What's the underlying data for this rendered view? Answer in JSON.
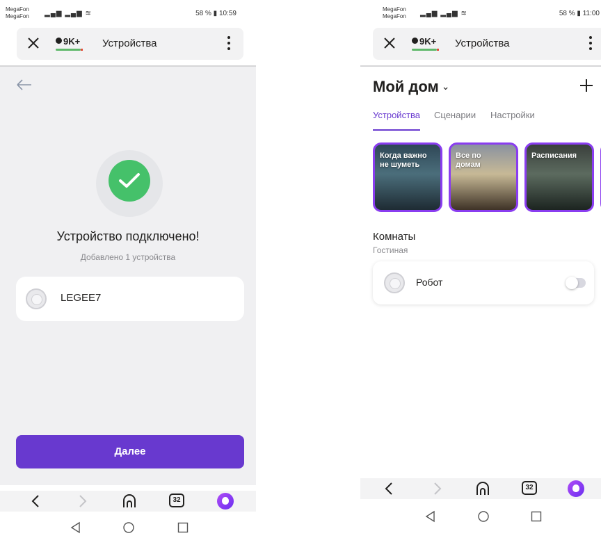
{
  "left_screen": {
    "status_bar": {
      "carrier_1": "MegaFon",
      "carrier_2": "MegaFon",
      "right_icons": "58 %",
      "time": "10:59"
    },
    "browser_bar": {
      "badge": "9K+",
      "title": "Устройства"
    },
    "success": {
      "title": "Устройство подключено!",
      "subtitle": "Добавлено 1 устройства"
    },
    "device": {
      "name": "LEGEE7"
    },
    "next_button": "Далее",
    "browser_nav": {
      "tabs_count": "32"
    }
  },
  "right_screen": {
    "status_bar": {
      "carrier_1": "MegaFon",
      "carrier_2": "MegaFon",
      "right_icons": "58 %",
      "time": "11:00"
    },
    "browser_bar": {
      "badge": "9K+",
      "title": "Устройства"
    },
    "home": {
      "title": "Мой дом"
    },
    "tabs": [
      {
        "label": "Устройства"
      },
      {
        "label": "Сценарии"
      },
      {
        "label": "Настройки"
      }
    ],
    "stories": [
      {
        "label": "Когда важно не шуметь"
      },
      {
        "label": "Все по домам"
      },
      {
        "label": "Расписания"
      }
    ],
    "rooms": {
      "title": "Комнаты",
      "room_name": "Гостиная"
    },
    "device": {
      "name": "Робот",
      "enabled": false
    },
    "browser_nav": {
      "tabs_count": "32"
    }
  },
  "colors": {
    "accent_purple": "#6839cf",
    "success_green": "#45c16a",
    "story_border": "#8a3df0"
  }
}
